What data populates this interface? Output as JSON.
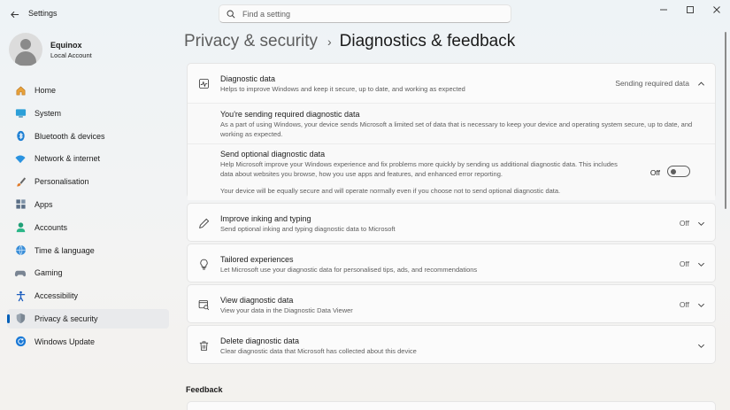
{
  "window": {
    "title": "Settings",
    "controls": {
      "minimize": "minimize-icon",
      "maximize": "maximize-icon",
      "close": "close-icon"
    }
  },
  "search": {
    "placeholder": "Find a setting",
    "value": ""
  },
  "profile": {
    "name": "Equinox",
    "account_type": "Local Account"
  },
  "sidebar": {
    "items": [
      {
        "label": "Home",
        "icon": "home-icon"
      },
      {
        "label": "System",
        "icon": "system-icon"
      },
      {
        "label": "Bluetooth & devices",
        "icon": "bluetooth-icon"
      },
      {
        "label": "Network & internet",
        "icon": "wifi-icon"
      },
      {
        "label": "Personalisation",
        "icon": "brush-icon"
      },
      {
        "label": "Apps",
        "icon": "apps-icon"
      },
      {
        "label": "Accounts",
        "icon": "accounts-icon"
      },
      {
        "label": "Time & language",
        "icon": "globe-icon"
      },
      {
        "label": "Gaming",
        "icon": "gaming-icon"
      },
      {
        "label": "Accessibility",
        "icon": "accessibility-icon"
      },
      {
        "label": "Privacy & security",
        "icon": "shield-icon",
        "active": true
      },
      {
        "label": "Windows Update",
        "icon": "update-icon"
      }
    ]
  },
  "breadcrumb": {
    "parent": "Privacy & security",
    "separator": "›",
    "current": "Diagnostics & feedback"
  },
  "main": {
    "diagnostic_data": {
      "title": "Diagnostic data",
      "description": "Helps to improve Windows and keep it secure, up to date, and working as expected",
      "status": "Sending required data",
      "required": {
        "title": "You're sending required diagnostic data",
        "text": "As a part of using Windows, your device sends Microsoft a limited set of data that is necessary to keep your device and operating system secure, up to date, and working as expected."
      },
      "optional": {
        "title": "Send optional diagnostic data",
        "text": "Help Microsoft improve your Windows experience and fix problems more quickly by sending us additional diagnostic data. This includes data about websites you browse, how you use apps and features, and enhanced error reporting.",
        "note": "Your device will be equally secure and will operate normally even if you choose not to send optional diagnostic data.",
        "toggle_label": "Off"
      }
    },
    "inking": {
      "title": "Improve inking and typing",
      "description": "Send optional inking and typing diagnostic data to Microsoft",
      "status": "Off"
    },
    "tailored": {
      "title": "Tailored experiences",
      "description": "Let Microsoft use your diagnostic data for personalised tips, ads, and recommendations",
      "status": "Off"
    },
    "view": {
      "title": "View diagnostic data",
      "description": "View your data in the Diagnostic Data Viewer",
      "status": "Off"
    },
    "delete": {
      "title": "Delete diagnostic data",
      "description": "Clear diagnostic data that Microsoft has collected about this device"
    },
    "feedback_section": "Feedback"
  },
  "colors": {
    "accent": "#005fb8",
    "background": "#f3f3f3",
    "card": "#fbfbfb",
    "text_secondary": "#5d5d5d"
  }
}
